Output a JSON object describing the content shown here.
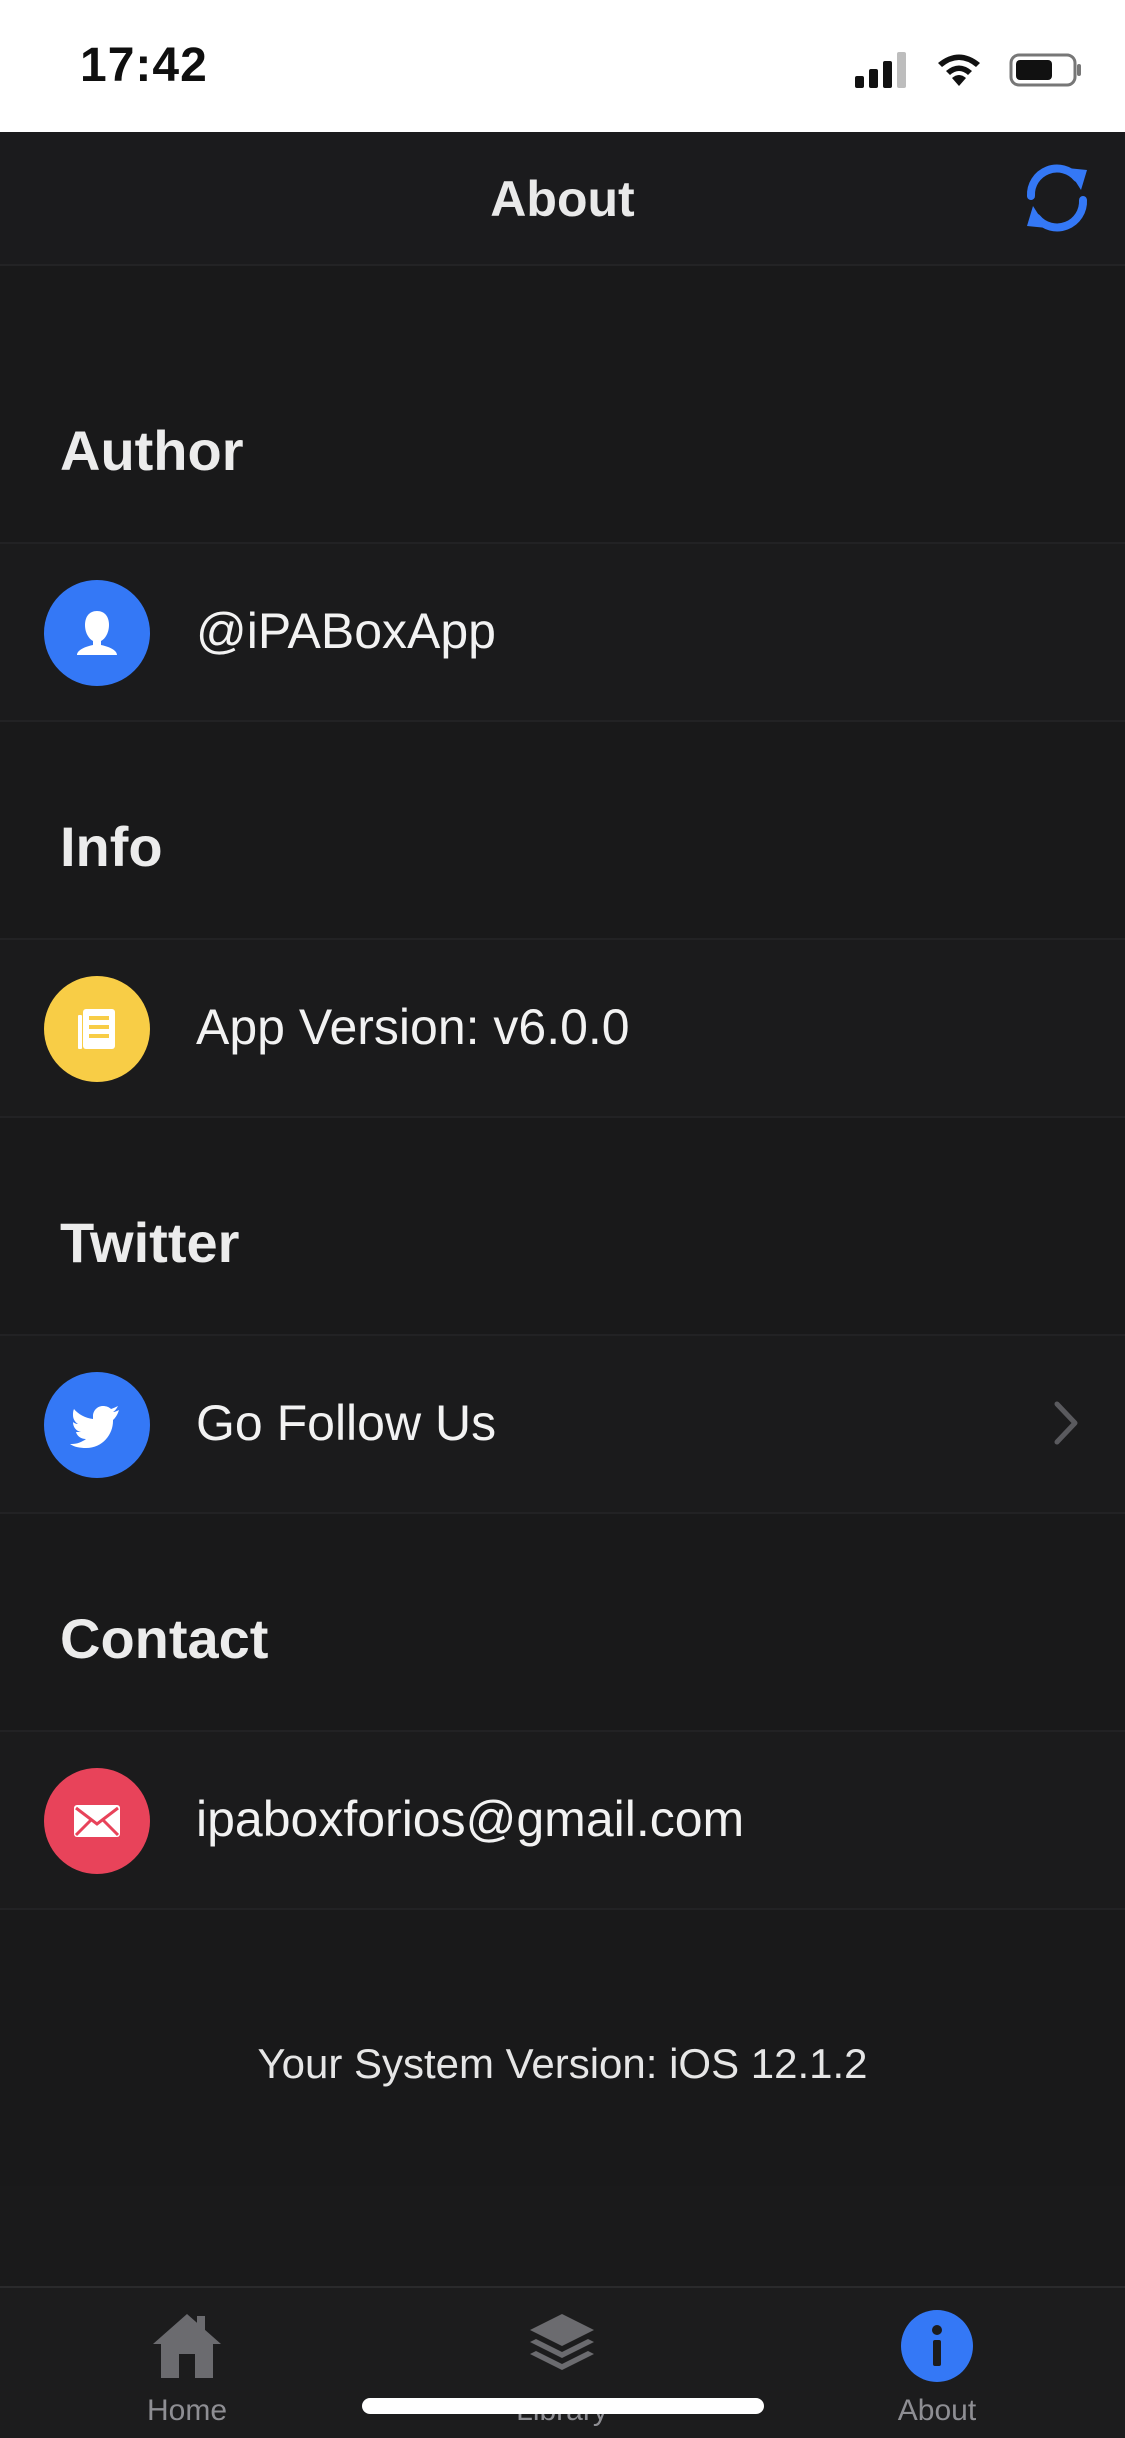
{
  "status_bar": {
    "time": "17:42",
    "icons": [
      "signal-icon",
      "wifi-icon",
      "battery-icon"
    ]
  },
  "nav": {
    "title": "About",
    "refresh_icon": "refresh-icon"
  },
  "sections": {
    "author": {
      "header": "Author",
      "label": "@iPABoxApp",
      "icon": "person-icon",
      "color": "#3478f6"
    },
    "info": {
      "header": "Info",
      "label": "App Version: v6.0.0",
      "icon": "document-icon",
      "color": "#f8cd46"
    },
    "twitter": {
      "header": "Twitter",
      "label": "Go Follow Us",
      "icon": "twitter-icon",
      "color": "#3478f6"
    },
    "contact": {
      "header": "Contact",
      "label": "ipaboxforios@gmail.com",
      "icon": "mail-icon",
      "color": "#e8435a"
    }
  },
  "footer": {
    "system_version": "Your System Version: iOS 12.1.2"
  },
  "tabs": [
    {
      "label": "Home",
      "icon": "home-icon"
    },
    {
      "label": "Library",
      "icon": "layers-icon"
    },
    {
      "label": "About",
      "icon": "info-icon",
      "active": true
    }
  ],
  "colors": {
    "accent": "#3478f6",
    "background": "#19191a",
    "tab_inactive": "#8e8e93"
  }
}
